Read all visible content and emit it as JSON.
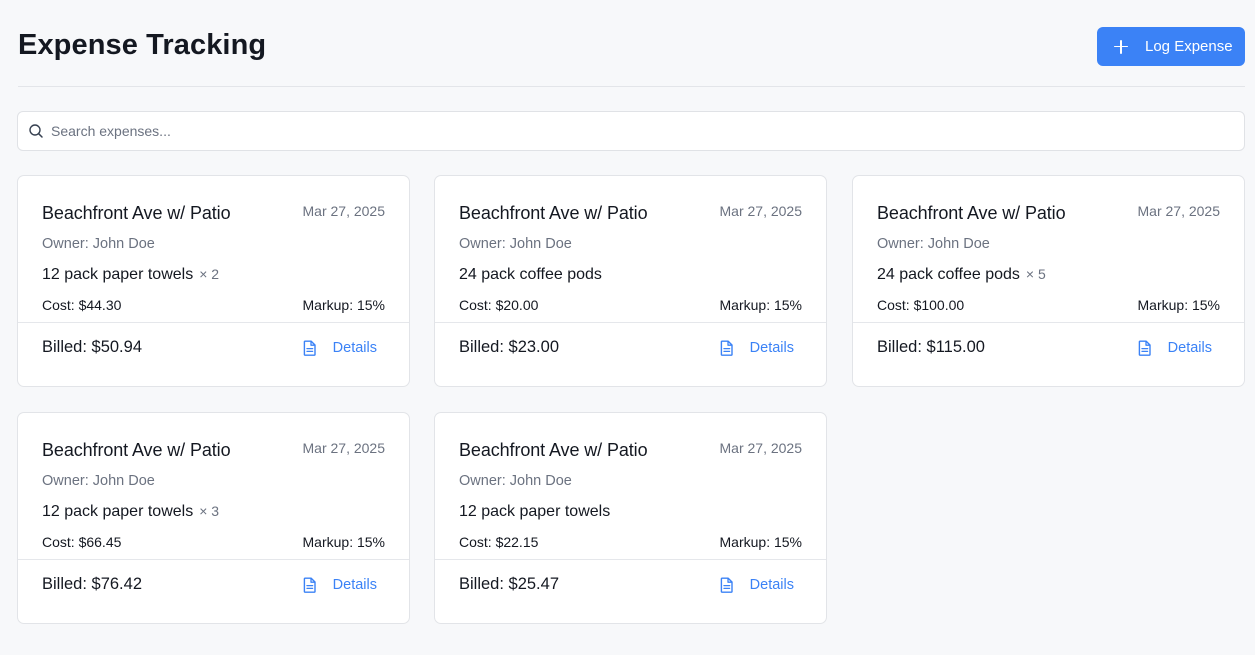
{
  "header": {
    "title": "Expense Tracking",
    "log_button_label": "Log Expense"
  },
  "search": {
    "placeholder": "Search expenses...",
    "value": ""
  },
  "colors": {
    "accent": "#3b82f6",
    "background": "#f7f8fa"
  },
  "expenses": [
    {
      "property": "Beachfront Ave w/ Patio",
      "date": "Mar 27, 2025",
      "owner": "Owner: John Doe",
      "item": "12 pack paper towels",
      "qty": "× 2",
      "cost": "Cost: $44.30",
      "markup": "Markup: 15%",
      "billed": "Billed: $50.94",
      "details_label": "Details"
    },
    {
      "property": "Beachfront Ave w/ Patio",
      "date": "Mar 27, 2025",
      "owner": "Owner: John Doe",
      "item": "24 pack coffee pods",
      "qty": "",
      "cost": "Cost: $20.00",
      "markup": "Markup: 15%",
      "billed": "Billed: $23.00",
      "details_label": "Details"
    },
    {
      "property": "Beachfront Ave w/ Patio",
      "date": "Mar 27, 2025",
      "owner": "Owner: John Doe",
      "item": "24 pack coffee pods",
      "qty": "× 5",
      "cost": "Cost: $100.00",
      "markup": "Markup: 15%",
      "billed": "Billed: $115.00",
      "details_label": "Details"
    },
    {
      "property": "Beachfront Ave w/ Patio",
      "date": "Mar 27, 2025",
      "owner": "Owner: John Doe",
      "item": "12 pack paper towels",
      "qty": "× 3",
      "cost": "Cost: $66.45",
      "markup": "Markup: 15%",
      "billed": "Billed: $76.42",
      "details_label": "Details"
    },
    {
      "property": "Beachfront Ave w/ Patio",
      "date": "Mar 27, 2025",
      "owner": "Owner: John Doe",
      "item": "12 pack paper towels",
      "qty": "",
      "cost": "Cost: $22.15",
      "markup": "Markup: 15%",
      "billed": "Billed: $25.47",
      "details_label": "Details"
    }
  ]
}
